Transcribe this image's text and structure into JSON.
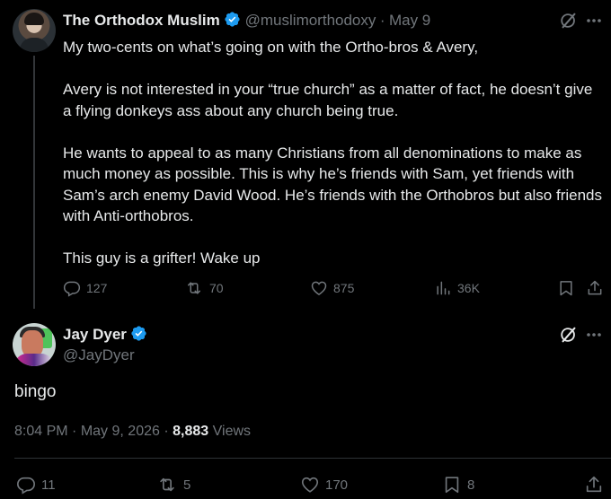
{
  "tweet1": {
    "name": "The Orthodox Muslim",
    "handle": "@muslimorthodoxy",
    "separator": "·",
    "date": "May 9",
    "paragraphs": [
      "My two-cents on what’s going on with the Ortho-bros & Avery,",
      "Avery is not interested in your “true church” as a matter of fact, he doesn’t give a flying donkeys ass about any church being true.",
      "He wants to appeal to as many Christians from all denominations to make as much money as possible. This is why he’s friends with Sam, yet friends with Sam’s arch enemy David Wood. He’s friends with the Orthobros but also friends with Anti-orthobros.",
      "This guy is a grifter! Wake up"
    ],
    "replies": "127",
    "reposts": "70",
    "likes": "875",
    "views": "36K"
  },
  "tweet2": {
    "name": "Jay Dyer",
    "handle": "@JayDyer",
    "text": "bingo",
    "time": "8:04 PM",
    "separator": "·",
    "date": "May 9, 2026",
    "separator2": "·",
    "views_count": "8,883",
    "views_label": "Views",
    "replies": "11",
    "reposts": "5",
    "likes": "170",
    "bookmarks": "8"
  },
  "colors": {
    "background": "#000000",
    "text": "#e7e9ea",
    "muted": "#71767b",
    "verified": "#1d9bf0"
  },
  "icons": [
    "verified-badge-icon",
    "grok-icon",
    "more-icon",
    "reply-icon",
    "repost-icon",
    "like-icon",
    "views-icon",
    "bookmark-icon",
    "share-icon"
  ]
}
